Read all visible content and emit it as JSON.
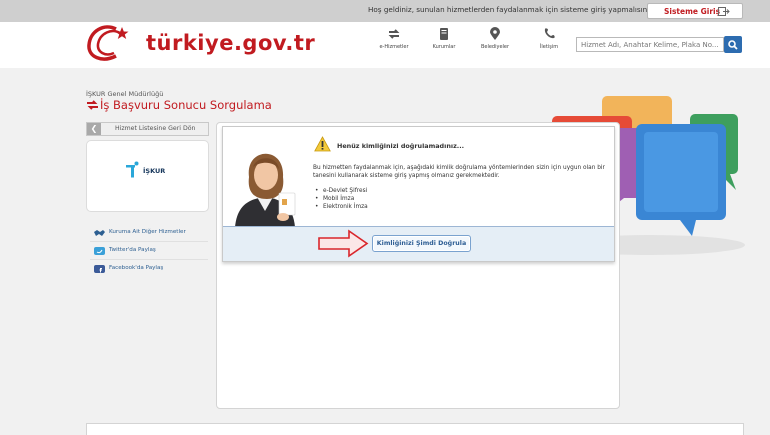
{
  "topbar": {
    "welcome_text": "Hoş geldiniz, sunulan hizmetlerden faydalanmak için sisteme giriş yapmalısınız.",
    "login_label": "Sisteme Giriş"
  },
  "header": {
    "logo_text": "türkiye.gov.tr",
    "nav": [
      {
        "label": "e-Hizmetler",
        "icon": "services-icon"
      },
      {
        "label": "Kurumlar",
        "icon": "book-icon"
      },
      {
        "label": "Belediyeler",
        "icon": "location-pin-icon"
      },
      {
        "label": "İletişim",
        "icon": "phone-icon"
      }
    ],
    "search_placeholder": "Hizmet Adı, Anahtar Kelime, Plaka No..."
  },
  "page": {
    "organization": "İŞKUR Genel Müdürlüğü",
    "title": "İş Başvuru Sonucu Sorgulama"
  },
  "sidebar": {
    "back_label": "Hizmet Listesine Geri Dön",
    "logo_text": "İŞKUR",
    "links": [
      {
        "label": "Kuruma Ait Diğer Hizmetler",
        "icon": "handshake-icon"
      },
      {
        "label": "Twitter'da Paylaş",
        "icon": "twitter-icon"
      },
      {
        "label": "Facebook'da Paylaş",
        "icon": "facebook-icon"
      }
    ]
  },
  "notice": {
    "title": "Henüz kimliğinizi doğrulamadınız...",
    "text": "Bu hizmetten faydalanmak için, aşağıdaki kimlik doğrulama yöntemlerinden sizin için uygun olan bir tanesini kullanarak sisteme giriş yapmış olmanız gerekmektedir.",
    "methods": [
      "e-Devlet Şifresi",
      "Mobil İmza",
      "Elektronik İmza"
    ],
    "verify_label": "Kimliğinizi Şimdi Doğrula"
  },
  "colors": {
    "brand_red": "#c11b20",
    "link_blue": "#2d5f91",
    "button_blue": "#2d6cb0"
  }
}
